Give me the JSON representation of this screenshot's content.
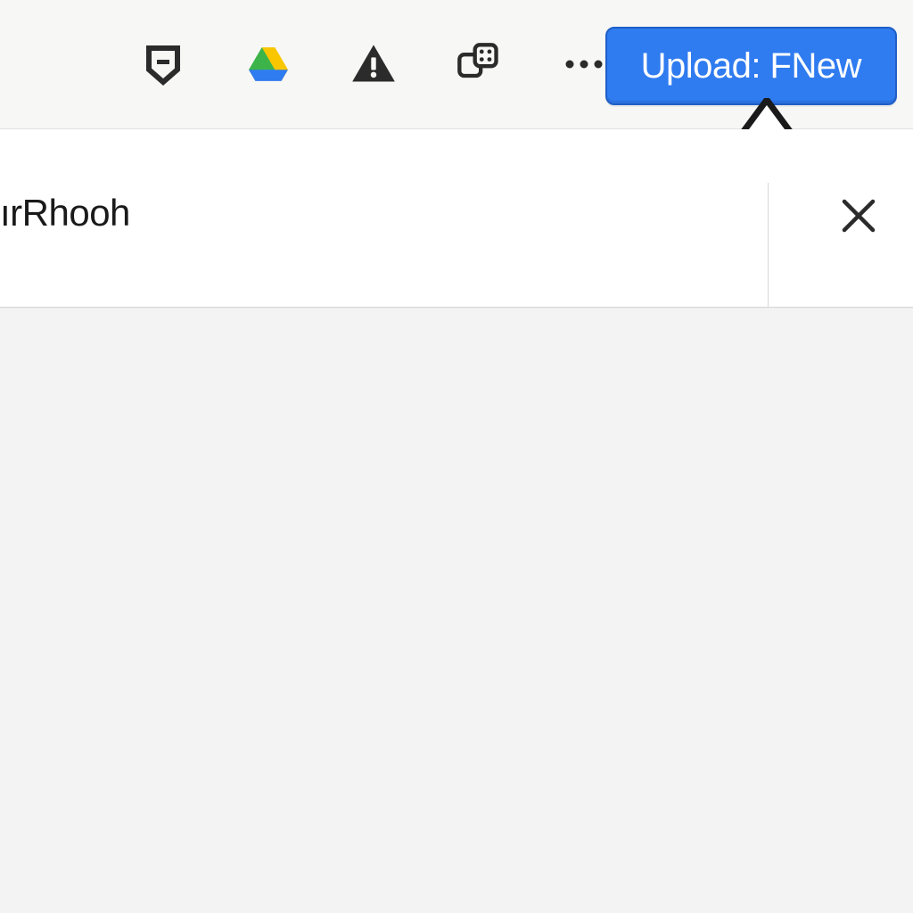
{
  "toolbar": {
    "icons": {
      "pocket": "pocket-icon",
      "drive": "google-drive-icon",
      "warning": "warning-icon",
      "puzzle": "extensions-icon",
      "overflow": "overflow-menu-icon"
    },
    "upload_button_label": "Upload: FNew"
  },
  "panel": {
    "text": "ırRhooh",
    "close_label": "Close"
  },
  "colors": {
    "button_bg": "#2f7bf0",
    "button_border": "#1f5fc7",
    "toolbar_bg": "#f7f7f6",
    "surface": "#ffffff",
    "canvas": "#f3f3f3",
    "icon_dark": "#2b2b2b",
    "drive_green": "#3cb44a",
    "drive_yellow": "#f9c600",
    "drive_blue": "#2f7bf0"
  }
}
